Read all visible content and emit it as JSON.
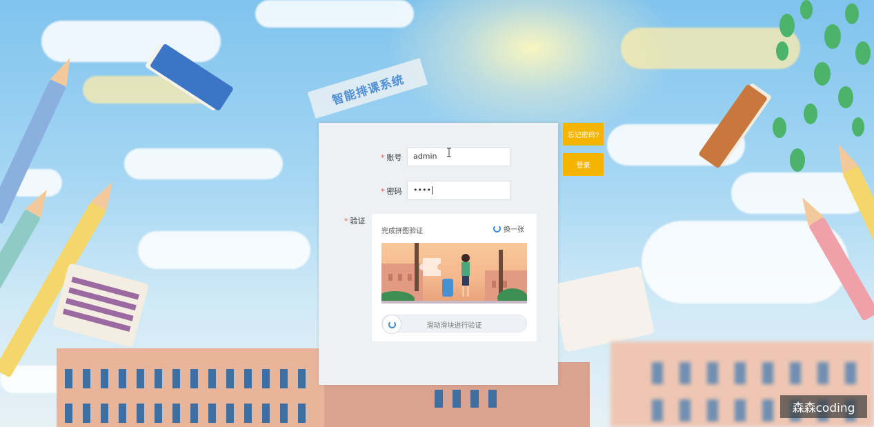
{
  "app": {
    "title": "智能排课系统"
  },
  "form": {
    "account_label": "账号",
    "account_value": "admin",
    "password_label": "密码",
    "password_value": "••••",
    "captcha_label": "验证",
    "required_mark": "*"
  },
  "captcha": {
    "heading": "完成拼图验证",
    "refresh_label": "换一张",
    "slider_hint": "滑动滑块进行验证"
  },
  "buttons": {
    "forgot_password": "忘记密码?",
    "login": "登录"
  },
  "watermark": {
    "text": "森森coding"
  },
  "colors": {
    "accent": "#f5b400",
    "title_text": "#4f8fd5",
    "required": "#f05a4a"
  }
}
